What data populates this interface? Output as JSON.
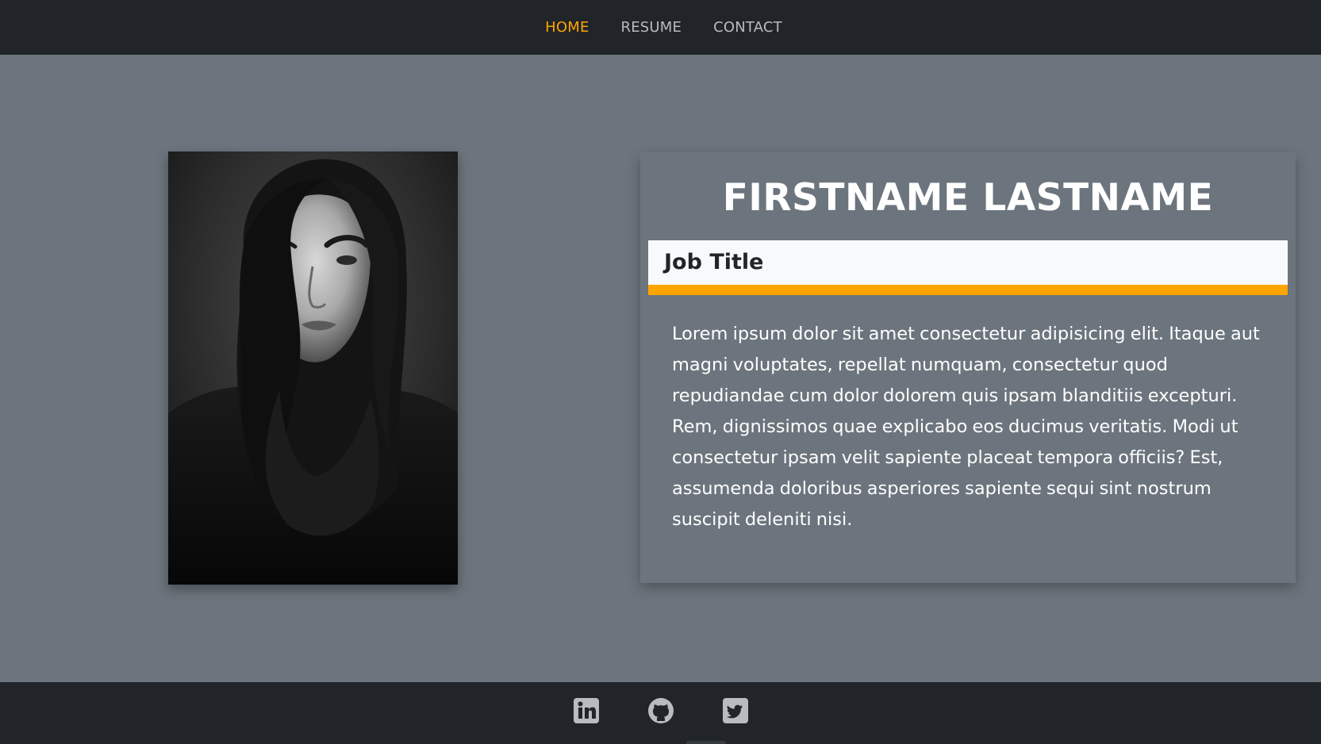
{
  "nav": {
    "items": [
      {
        "label": "HOME",
        "active": true
      },
      {
        "label": "RESUME",
        "active": false
      },
      {
        "label": "CONTACT",
        "active": false
      }
    ],
    "active_color": "#ffa500"
  },
  "profile": {
    "name": "FIRSTNAME LASTNAME",
    "job_title": "Job Title",
    "bio": "Lorem ipsum dolor sit amet consectetur adipisicing elit. Itaque aut magni voluptates, repellat numquam, consectetur quod repudiandae cum dolor dolorem quis ipsam blanditiis excepturi. Rem, dignissimos quae explicabo eos ducimus veritatis. Modi ut consectetur ipsam velit sapiente placeat tempora officiis? Est, assumenda doloribus asperiores sapiente sequi sint nostrum suscipit deleniti nisi."
  },
  "footer": {
    "social_icons": [
      "linkedin-icon",
      "github-icon",
      "twitter-icon"
    ]
  },
  "colors": {
    "navbar_bg": "#212529",
    "page_bg": "#6c757d",
    "accent": "#ffa500",
    "title_bar_bg": "#f8f9fa"
  }
}
